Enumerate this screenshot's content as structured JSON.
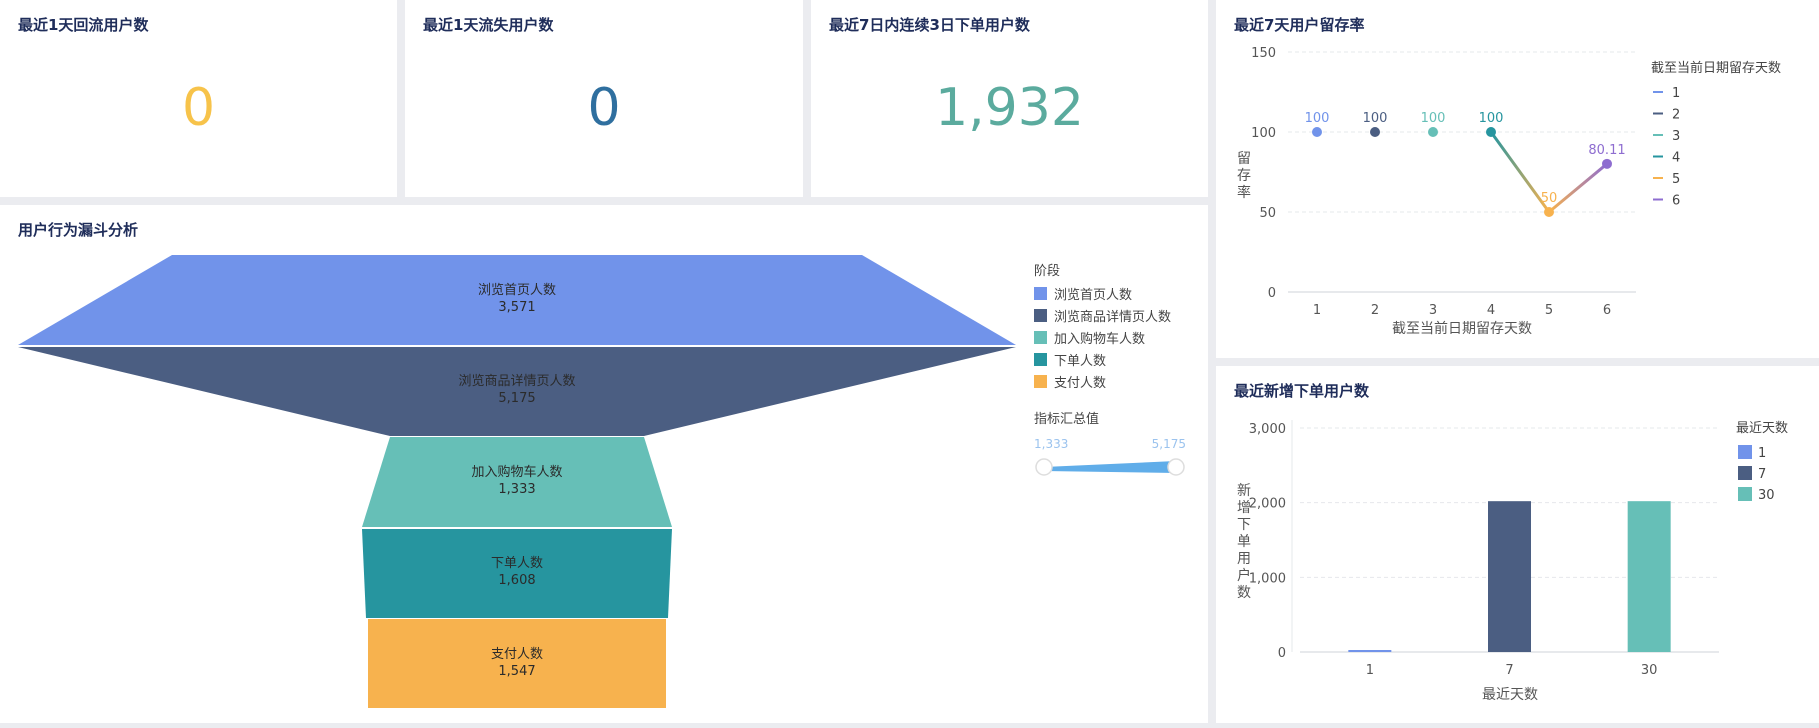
{
  "kpis": [
    {
      "title": "最近1天回流用户数",
      "value": "0",
      "color": "#f7c34a"
    },
    {
      "title": "最近1天流失用户数",
      "value": "0",
      "color": "#2f6f9f"
    },
    {
      "title": "最近7日内连续3日下单用户数",
      "value": "1,932",
      "color": "#5bab9e"
    }
  ],
  "funnel": {
    "title": "用户行为漏斗分析",
    "legend_title": "阶段",
    "stages": [
      {
        "label": "浏览首页人数",
        "value": "3,571",
        "color": "#7193ea"
      },
      {
        "label": "浏览商品详情页人数",
        "value": "5,175",
        "color": "#4b5e82"
      },
      {
        "label": "加入购物车人数",
        "value": "1,333",
        "color": "#66bfb7"
      },
      {
        "label": "下单人数",
        "value": "1,608",
        "color": "#26959f"
      },
      {
        "label": "支付人数",
        "value": "1,547",
        "color": "#f7b24e"
      }
    ],
    "range_title": "指标汇总值",
    "range_min": "1,333",
    "range_max": "5,175"
  },
  "retention": {
    "title": "最近7天用户留存率",
    "legend_title": "截至当前日期留存天数",
    "chart_data": {
      "type": "line",
      "x": [
        1,
        2,
        3,
        4,
        5,
        6
      ],
      "values": [
        100,
        100,
        100,
        100,
        50,
        80.11
      ],
      "point_labels": [
        "100",
        "100",
        "100",
        "100",
        "50",
        "80.11"
      ],
      "point_colors": [
        "#7193ea",
        "#4b5e82",
        "#66bfb7",
        "#26959f",
        "#f7b24e",
        "#8e6dd0"
      ],
      "xlabel": "截至当前日期留存天数",
      "ylabel": "留存率",
      "ylim": [
        0,
        150
      ],
      "yticks": [
        "0",
        "50",
        "100",
        "150"
      ],
      "xticks": [
        "1",
        "2",
        "3",
        "4",
        "5",
        "6"
      ],
      "legend": [
        "1",
        "2",
        "3",
        "4",
        "5",
        "6"
      ],
      "grid": true,
      "legend_position": "right"
    }
  },
  "new_orders": {
    "title": "最近新增下单用户数",
    "legend_title": "最近天数",
    "chart_data": {
      "type": "bar",
      "categories": [
        "1",
        "7",
        "30"
      ],
      "values": [
        10,
        2020,
        2020
      ],
      "colors": [
        "#7193ea",
        "#4b5e82",
        "#66bfb7"
      ],
      "xlabel": "最近天数",
      "ylabel": "新增下单用户数",
      "ylim": [
        0,
        3000
      ],
      "yticks": [
        "0",
        "1,000",
        "2,000",
        "3,000"
      ],
      "legend": [
        "1",
        "7",
        "30"
      ],
      "grid": true,
      "legend_position": "right"
    }
  }
}
